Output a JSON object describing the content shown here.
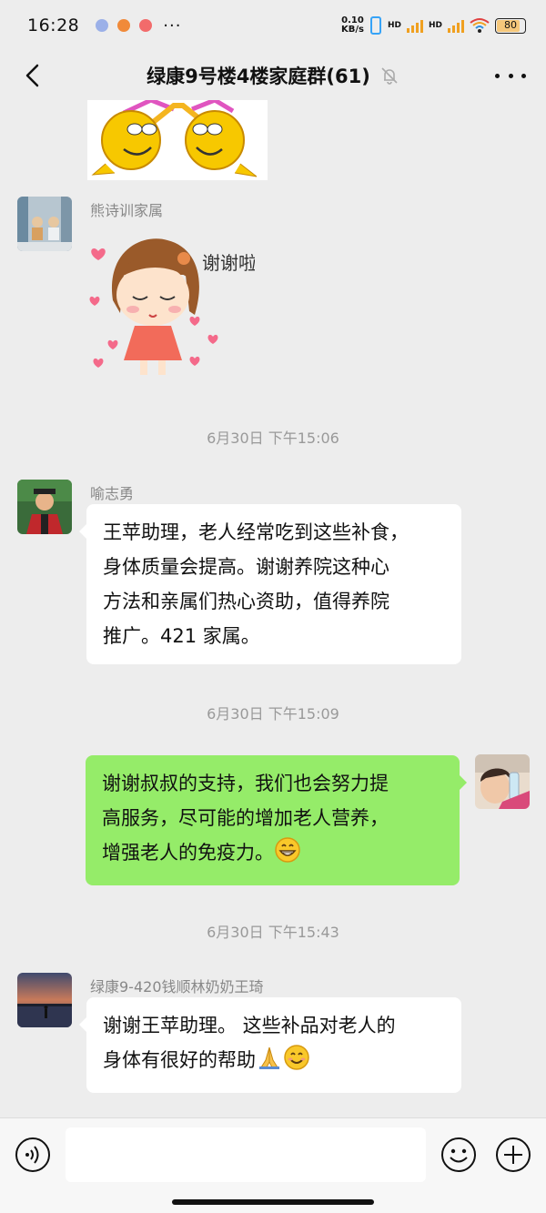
{
  "status_bar": {
    "time": "16:28",
    "more_dots": "···",
    "net_speed_value": "0.10",
    "net_speed_unit": "KB/s",
    "hd1": "HD",
    "hd2": "HD",
    "battery": "80"
  },
  "header": {
    "title": "绿康9号楼4楼家庭群(61)"
  },
  "messages": [
    {
      "sender": "熊诗训家属",
      "type": "sticker",
      "sticker_text": "谢谢啦!"
    },
    {
      "timestamp": "6月30日 下午15:06"
    },
    {
      "sender": "喻志勇",
      "text": "王苹助理，老人经常吃到这些补食，身体质量会提高。谢谢养院这种心方法和亲属们热心资助，值得养院推广。421 家属。",
      "lines": [
        "王苹助理，老人经常吃到这些补食，",
        "身体质量会提高。谢谢养院这种心",
        "方法和亲属们热心资助，值得养院",
        "推广。421 家属。"
      ]
    },
    {
      "timestamp": "6月30日 下午15:09"
    },
    {
      "sender": "self",
      "lines": [
        "谢谢叔叔的支持，我们也会努力提",
        "高服务，尽可能的增加老人营养，",
        "增强老人的免疫力。"
      ]
    },
    {
      "timestamp": "6月30日 下午15:43"
    },
    {
      "sender": "绿康9-420钱顺林奶奶王琦",
      "lines": [
        "谢谢王苹助理。 这些补品对老人的",
        "身体有很好的帮助"
      ]
    }
  ],
  "colors": {
    "background": "#ededed",
    "self_bubble": "#95ec69",
    "other_bubble": "#ffffff"
  }
}
